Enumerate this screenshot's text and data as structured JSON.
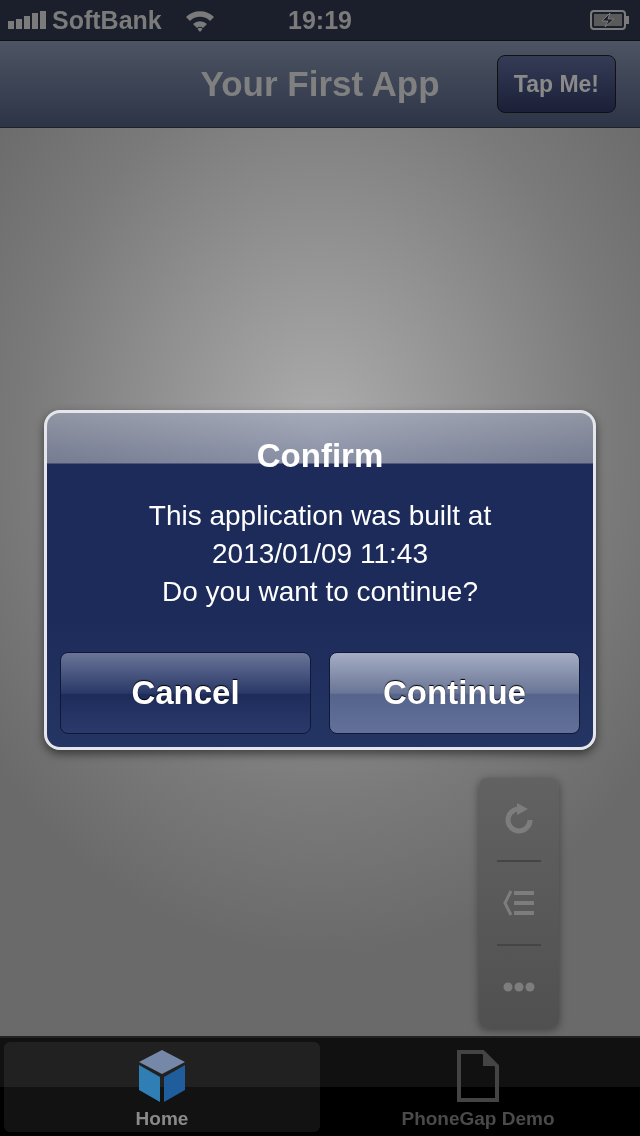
{
  "status_bar": {
    "carrier": "SoftBank",
    "time": "19:19"
  },
  "nav_bar": {
    "title": "Your First App",
    "button": "Tap Me!"
  },
  "dialog": {
    "title": "Confirm",
    "message_lines": [
      "This application was built at",
      "2013/01/09 11:43",
      "Do you want to continue?"
    ],
    "buttons": [
      {
        "label": "Cancel",
        "kind": "cancel"
      },
      {
        "label": "Continue",
        "kind": "default"
      }
    ]
  },
  "tool_buttons": [
    {
      "kind": "reload"
    },
    {
      "kind": "back-list"
    },
    {
      "kind": "more"
    }
  ],
  "tabs": [
    {
      "label": "Home",
      "selected": true
    },
    {
      "label": "PhoneGap Demo",
      "selected": false
    }
  ]
}
